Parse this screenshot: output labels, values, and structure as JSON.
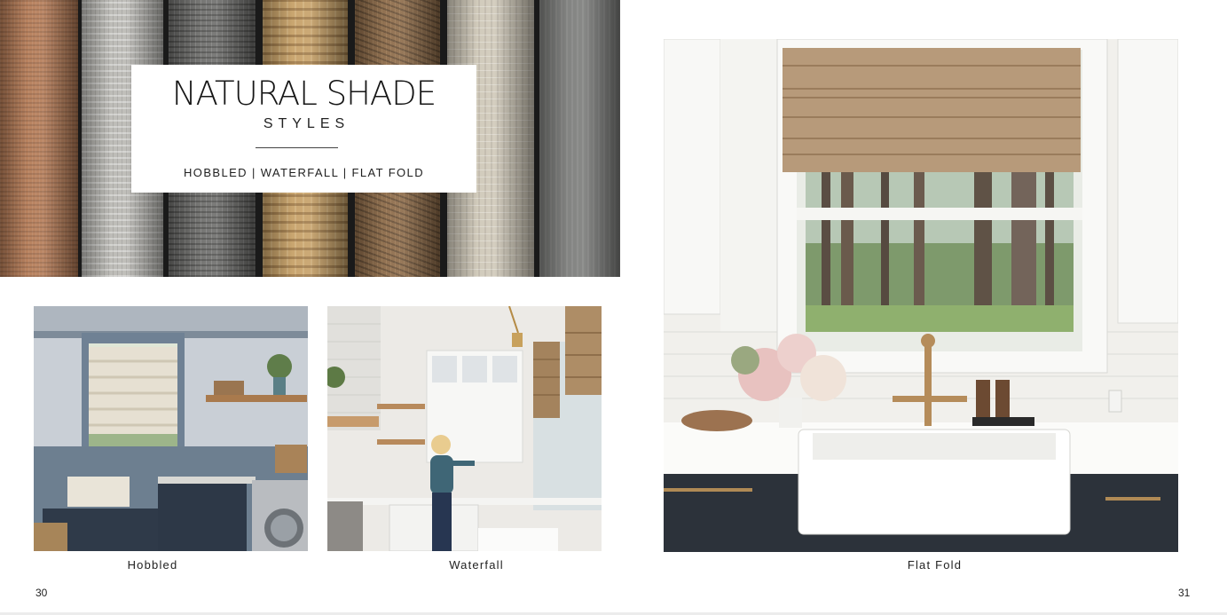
{
  "hero": {
    "title": "NATURAL SHADE",
    "subtitle": "STYLES",
    "styles_line": "HOBBLED | WATERFALL | FLAT FOLD"
  },
  "photos": {
    "hobbled": {
      "caption": "Hobbled"
    },
    "waterfall": {
      "caption": "Waterfall"
    },
    "flat_fold": {
      "caption": "Flat Fold"
    }
  },
  "pages": {
    "left": "30",
    "right": "31"
  }
}
